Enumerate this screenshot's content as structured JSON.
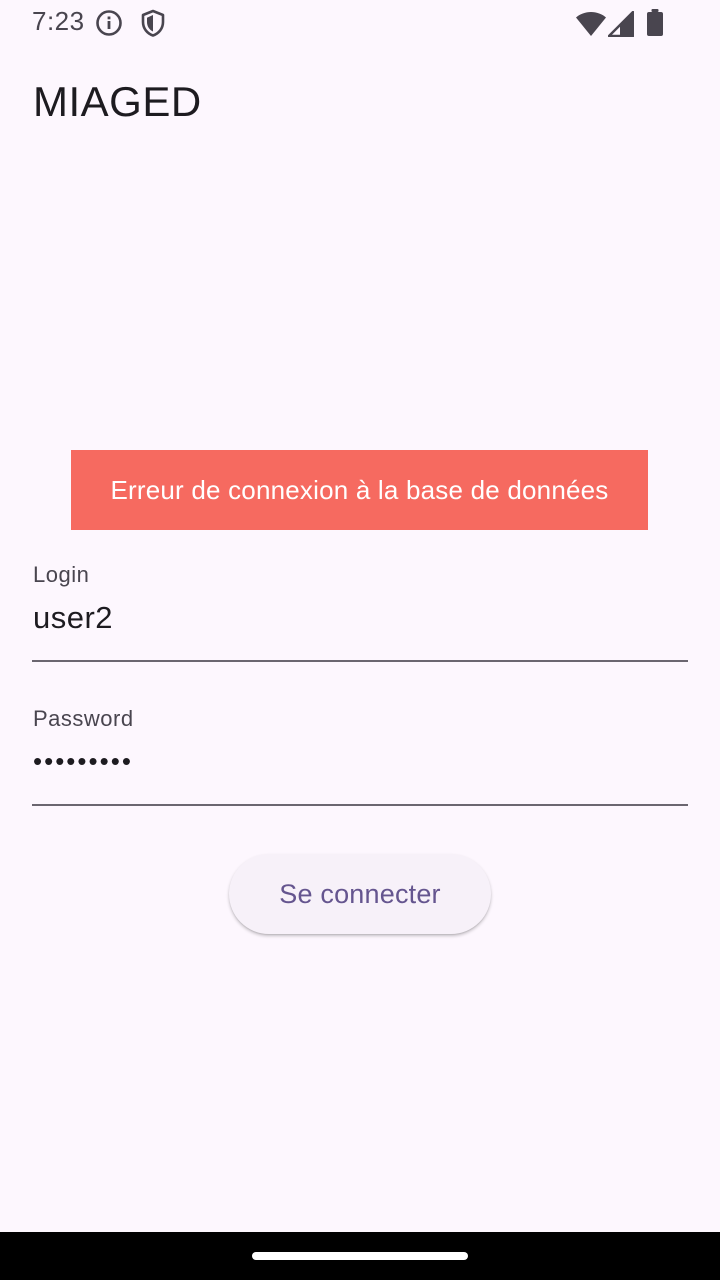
{
  "status_bar": {
    "time": "7:23",
    "icons": [
      "info-icon",
      "shield-icon",
      "wifi-icon",
      "cell-signal-icon",
      "battery-icon"
    ]
  },
  "app": {
    "title": "MIAGED"
  },
  "error": {
    "message": "Erreur de connexion à la base de données",
    "color": "#f66a60"
  },
  "form": {
    "login": {
      "label": "Login",
      "value": "user2"
    },
    "password": {
      "label": "Password",
      "value": "•••••••••"
    },
    "submit_label": "Se connecter"
  },
  "colors": {
    "background": "#fdf7fe",
    "accent": "#65558f"
  }
}
